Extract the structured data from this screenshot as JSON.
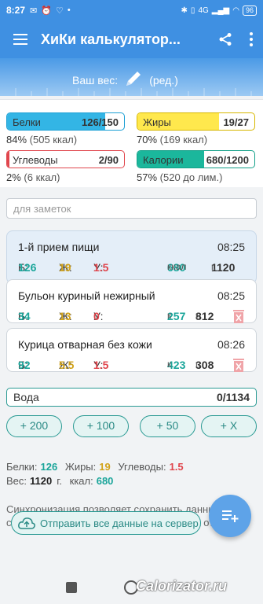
{
  "status": {
    "time": "8:27",
    "network": "4G",
    "battery": "96"
  },
  "app_bar": {
    "title": "ХиКи калькулятор..."
  },
  "weight": {
    "label": "Ваш вес:",
    "edit": "(ред.)"
  },
  "macros": {
    "protein": {
      "label": "Белки",
      "value": "126/150",
      "sub_pct": "84%",
      "sub_kcal": "(505 ккал)",
      "progress": 0.84,
      "color": "#33b5e5"
    },
    "fat": {
      "label": "Жиры",
      "value": "19/27",
      "sub_pct": "70%",
      "sub_kcal": "(169 ккал)",
      "progress": 0.7,
      "color": "#ffe84d"
    },
    "carbs": {
      "label": "Углеводы",
      "value": "2/90",
      "sub_pct": "2%",
      "sub_kcal": "(6 ккал)",
      "progress": 0.02,
      "color": "#e0454c"
    },
    "calories": {
      "label": "Калории",
      "value": "680/1200",
      "sub_pct": "57%",
      "sub_kcal": "(520 до лим.)",
      "progress": 0.57,
      "color": "#1bb79c"
    }
  },
  "notes": {
    "placeholder": "для заметок"
  },
  "meal_header": {
    "name": "1-й прием пищи",
    "time": "08:25",
    "b": "126",
    "zh": "19",
    "u": "1.5",
    "kcal": "680",
    "kcal_unit": "ккал",
    "grams": "1120",
    "g_unit": "г."
  },
  "items": [
    {
      "name": "Бульон куриный нежирный",
      "time": "08:25",
      "b": "34",
      "zh": "13",
      "u": "0",
      "kcal": "257",
      "kcal_unit": "к",
      "grams": "812",
      "g_unit": "г."
    },
    {
      "name": "Курица отварная без кожи",
      "time": "08:26",
      "b": "92",
      "zh": "5.5",
      "u": "1.5",
      "kcal": "423",
      "kcal_unit": "к",
      "grams": "308",
      "g_unit": "г."
    }
  ],
  "labels": {
    "b": "Б:",
    "zh": "Ж:",
    "u": "У:"
  },
  "water": {
    "label": "Вода",
    "value": "0/1134",
    "buttons": [
      "+ 200",
      "+ 100",
      "+ 50",
      "+ X"
    ]
  },
  "summary": {
    "protein_label": "Белки:",
    "protein": "126",
    "fat_label": "Жиры:",
    "fat": "19",
    "carbs_label": "Углеводы:",
    "carbs": "1.5",
    "weight_label": "Вес:",
    "weight": "1120",
    "weight_unit": "г.",
    "kcal_label": "ккал:",
    "kcal": "680"
  },
  "sync": {
    "text": "Синхронизация позволяет сохранить данные на сервер, расходуется интернет трафик на отправку",
    "button": "Отправить все данные на сервер"
  },
  "watermark": "Calorizator.ru"
}
